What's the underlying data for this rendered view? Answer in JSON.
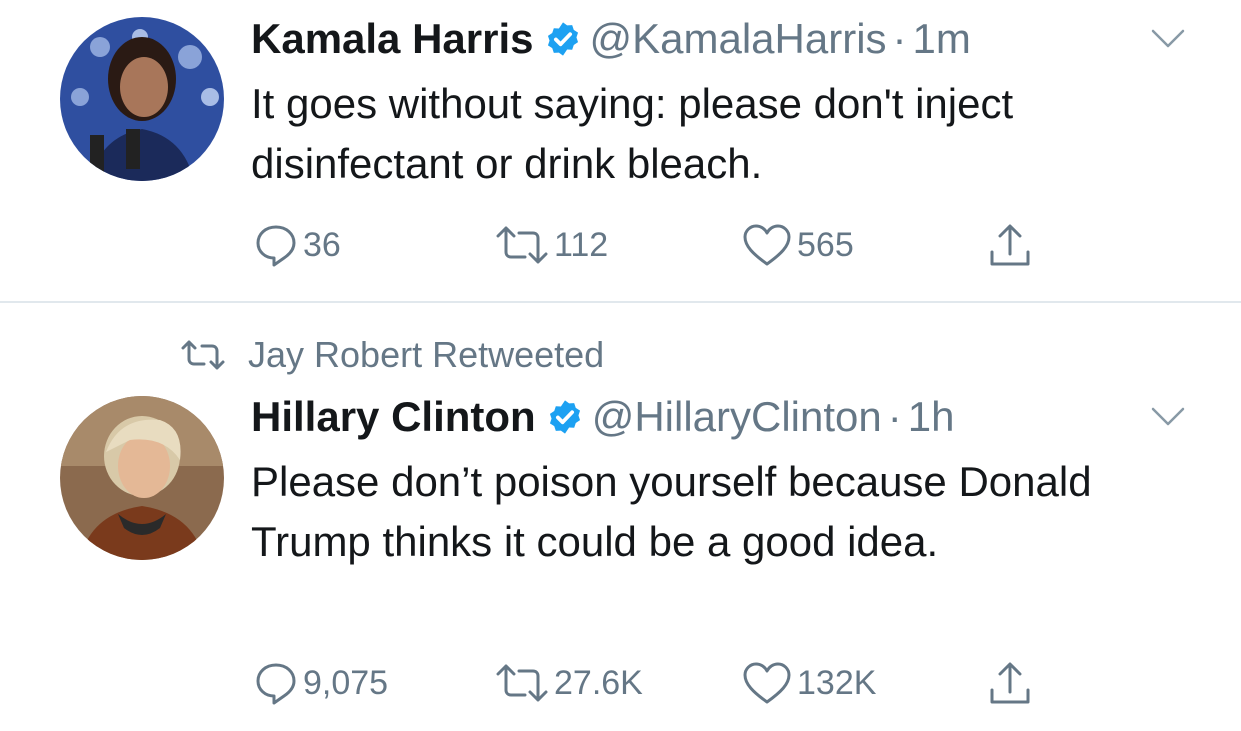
{
  "tweets": [
    {
      "name": "Kamala Harris",
      "handle": "@KamalaHarris",
      "separator": "·",
      "time": "1m",
      "text": "It goes without saying: please don't inject disinfectant or drink bleach.",
      "replies": "36",
      "retweets": "112",
      "likes": "565"
    },
    {
      "retweeted_by": "Jay Robert Retweeted",
      "name": "Hillary Clinton",
      "handle": "@HillaryClinton",
      "separator": "·",
      "time": "1h",
      "text": "Please don’t poison yourself because Donald Trump thinks it could be a good idea.",
      "replies": "9,075",
      "retweets": "27.6K",
      "likes": "132K"
    }
  ],
  "icons": {
    "reply": "reply-icon",
    "retweet": "retweet-icon",
    "like": "heart-icon",
    "share": "share-icon",
    "verified": "verified-badge-icon",
    "menu": "chevron-down-icon"
  },
  "colors": {
    "verified": "#1da1f2",
    "secondary_text": "#657786",
    "primary_text": "#14171a",
    "divider": "#e1e8ed"
  }
}
